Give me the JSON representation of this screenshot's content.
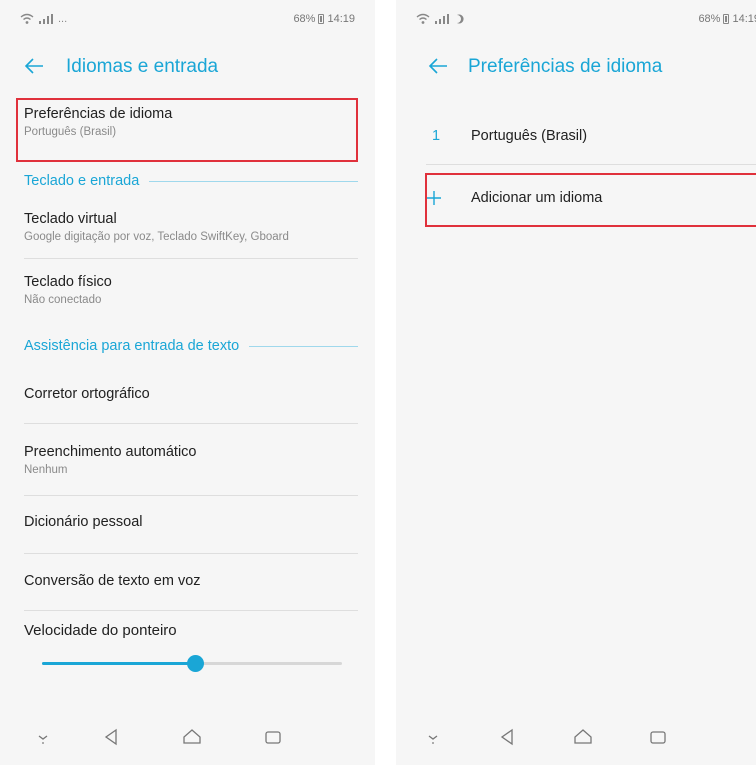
{
  "left": {
    "status": {
      "percent": "68%",
      "time": "14:19"
    },
    "title": "Idiomas e entrada",
    "lang_prefs": {
      "title": "Preferências de idioma",
      "summary": "Português (Brasil)"
    },
    "section_keyboard": "Teclado e entrada",
    "virtual_keyboard": {
      "title": "Teclado virtual",
      "summary": "Google digitação por voz, Teclado SwiftKey, Gboard"
    },
    "physical_keyboard": {
      "title": "Teclado físico",
      "summary": "Não conectado"
    },
    "section_assist": "Assistência para entrada de texto",
    "spell_checker": {
      "title": "Corretor ortográfico"
    },
    "autofill": {
      "title": "Preenchimento automático",
      "summary": "Nenhum"
    },
    "personal_dict": {
      "title": "Dicionário pessoal"
    },
    "tts": {
      "title": "Conversão de texto em voz"
    },
    "pointer_speed": {
      "title": "Velocidade do ponteiro",
      "value_fraction": 0.51
    }
  },
  "right": {
    "status": {
      "percent": "68%",
      "time": "14:19"
    },
    "title": "Preferências de idioma",
    "languages": [
      {
        "num": "1",
        "name": "Português (Brasil)"
      }
    ],
    "add_language": "Adicionar um idioma"
  },
  "colors": {
    "accent": "#1aa6d6",
    "highlight": "#e0313b",
    "background": "#f6f6f6"
  },
  "icons": [
    "wifi-icon",
    "signal-icon",
    "battery-icon",
    "back-arrow-icon",
    "plus-icon",
    "nav-down-icon",
    "nav-back-icon",
    "nav-home-icon",
    "nav-recents-icon"
  ]
}
